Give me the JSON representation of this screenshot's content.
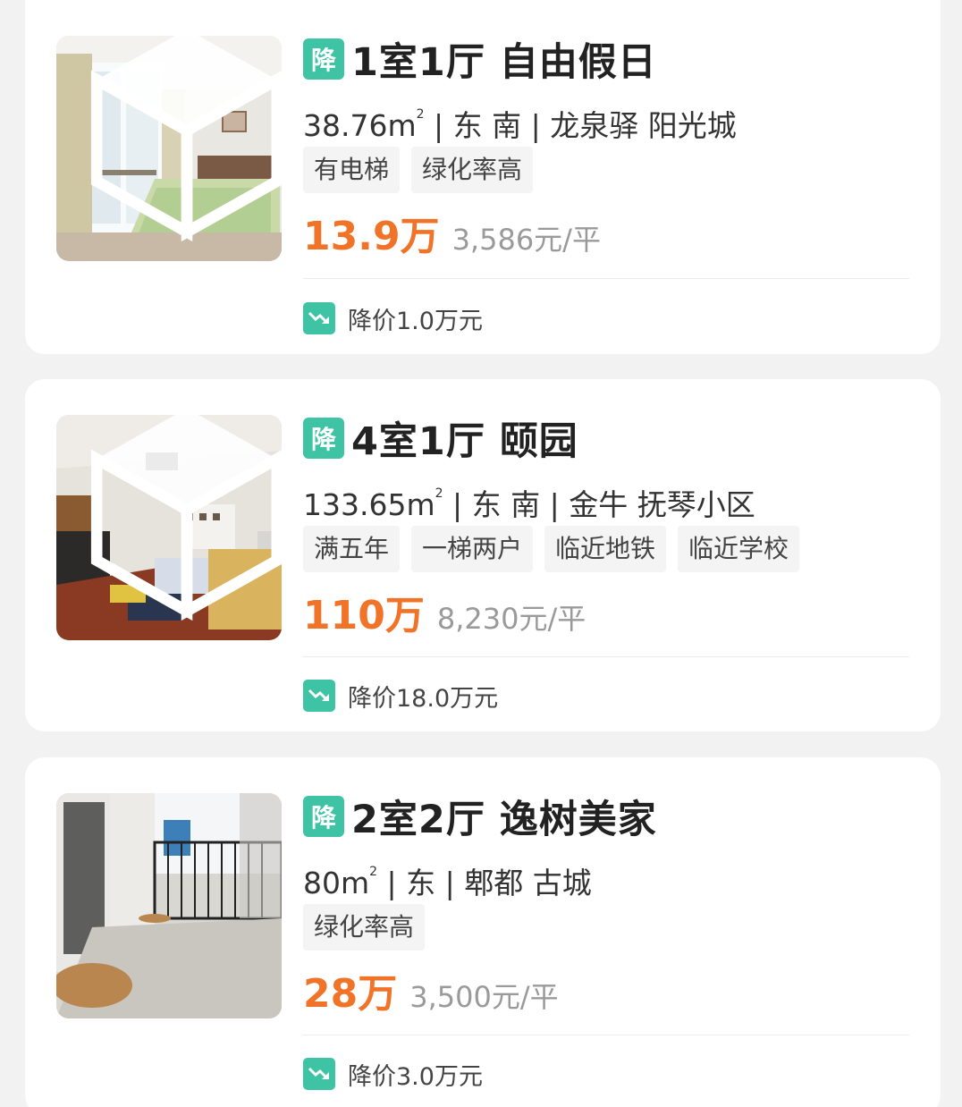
{
  "colors": {
    "accent": "#3ec3a4",
    "price": "#f17327",
    "muted": "#9a9a9a",
    "background": "#f2f2f2"
  },
  "listings": [
    {
      "badge": "降",
      "title": "1室1厅 自由假日",
      "area": "38.76m",
      "area_sup": "2",
      "details": " | 东 南 | 龙泉驿 阳光城",
      "tags": [
        "有电梯",
        "绿化率高"
      ],
      "price": "13.9万",
      "unit_price": "3,586元/平",
      "drop": "降价1.0万元",
      "photo_icon": "bedroom-photo"
    },
    {
      "badge": "降",
      "title": "4室1厅 颐园",
      "area": "133.65m",
      "area_sup": "2",
      "details": " | 东 南 | 金牛 抚琴小区",
      "tags": [
        "满五年",
        "一梯两户",
        "临近地铁",
        "临近学校"
      ],
      "price": "110万",
      "unit_price": "8,230元/平",
      "drop": "降价18.0万元",
      "photo_icon": "living-room-photo"
    },
    {
      "badge": "降",
      "title": "2室2厅 逸树美家",
      "area": "80m",
      "area_sup": "2",
      "details": " | 东 | 郫都 古城",
      "tags": [
        "绿化率高"
      ],
      "price": "28万",
      "unit_price": "3,500元/平",
      "drop": "降价3.0万元",
      "photo_icon": "balcony-photo"
    }
  ]
}
